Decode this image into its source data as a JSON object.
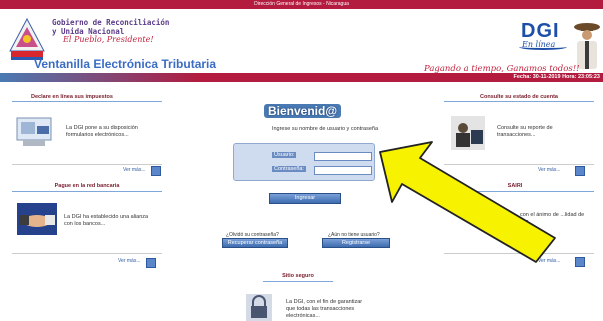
{
  "top_strip": {
    "text": "Dirección General de Ingresos - Nicaragua"
  },
  "header": {
    "gov_line1": "Gobierno de Reconciliación",
    "gov_line2": "y Unida Nacional",
    "gov_slogan": "El Pueblo, Presidente!",
    "vet_title": "Ventanilla Electrónica Tributaria",
    "dgi_logo": "DGI",
    "dgi_linea": "En línea",
    "tagline": "Pagando a tiempo, Ganamos todos!!"
  },
  "datebar": {
    "text": "Fecha: 30-11-2019 Hora: 23:05:23"
  },
  "left_panels": [
    {
      "title": "Declare en línea sus impuestos",
      "text": "La DGI pone a su disposición formularios electrónicos...",
      "more": "Ver más..."
    },
    {
      "title": "Pague en la red bancaria",
      "text": "La DGI ha establecido una alianza con los bancos...",
      "more": "Ver más..."
    }
  ],
  "right_panels": [
    {
      "title": "Consulte su estado de cuenta",
      "text": "Consulte su reporte de transacciones...",
      "more": "Ver más..."
    },
    {
      "title": "SAIRI",
      "text": "con el ánimo de ...lidad de sus",
      "more": "Ver más..."
    }
  ],
  "login": {
    "welcome": "Bienvenid@",
    "prompt": "Ingrese su nombre de usuario y contraseña",
    "user_label": "Usuario:",
    "password_label": "Contraseña:",
    "submit": "Ingresar",
    "forgot_q": "¿Olvidó su contraseña?",
    "recover": "Recuperar contraseña",
    "register_q": "¿Aún no tiene usuario?",
    "register": "Registrarse"
  },
  "secure": {
    "title": "Sitio seguro",
    "text": "La DGI, con el fin de garantizar que todas las transacciones electrónicas..."
  },
  "colors": {
    "brand_red": "#b31b3f",
    "brand_blue": "#1e4fa8",
    "arrow_yellow": "#f7f200"
  }
}
